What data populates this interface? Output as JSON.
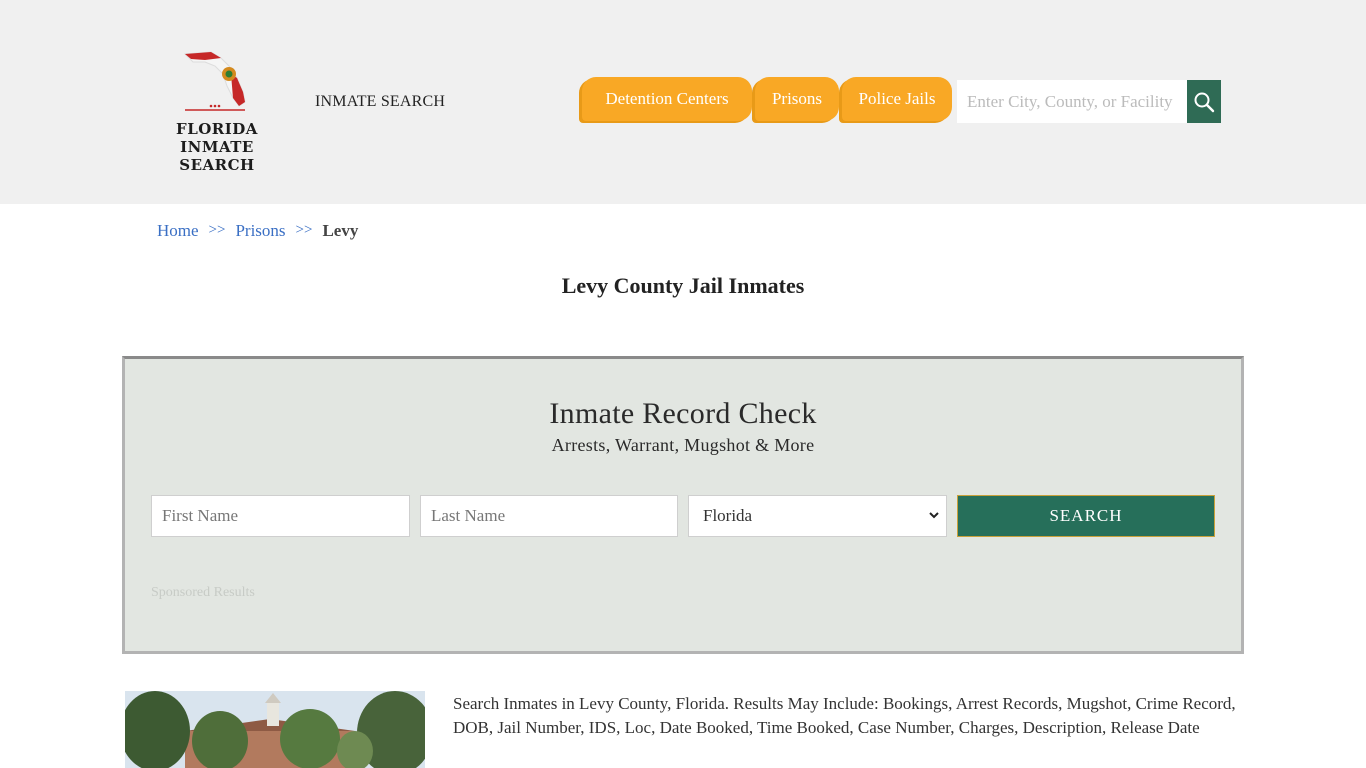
{
  "header": {
    "logo_line1": "FLORIDA",
    "logo_line2": "INMATE SEARCH",
    "site_link": "INMATE SEARCH",
    "nav": [
      {
        "label": "Detention Centers"
      },
      {
        "label": "Prisons"
      },
      {
        "label": "Police Jails"
      }
    ],
    "search_placeholder": "Enter City, County, or Facility"
  },
  "breadcrumb": {
    "home": "Home",
    "sep": ">>",
    "prisons": "Prisons",
    "current": "Levy"
  },
  "page_title": "Levy County Jail Inmates",
  "record_check": {
    "title": "Inmate Record Check",
    "subtitle": "Arrests, Warrant, Mugshot & More",
    "first_name_placeholder": "First Name",
    "last_name_placeholder": "Last Name",
    "state_selected": "Florida",
    "search_label": "SEARCH",
    "sponsored": "Sponsored Results"
  },
  "description": "Search Inmates in Levy County, Florida. Results May Include: Bookings, Arrest Records, Mugshot, Crime Record, DOB, Jail Number, IDS, Loc, Date Booked, Time Booked, Case Number, Charges, Description, Release Date",
  "colors": {
    "nav_orange": "#f9a825",
    "brand_green": "#266f5a",
    "link_blue": "#3a6fc4"
  }
}
